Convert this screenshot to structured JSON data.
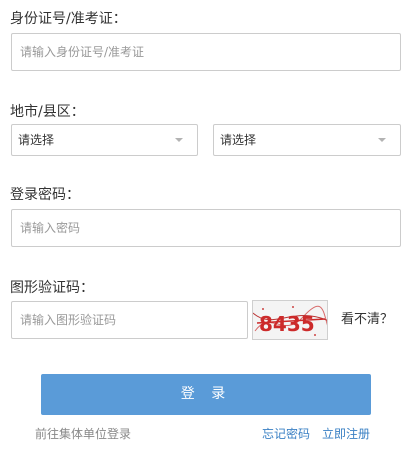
{
  "id_section": {
    "label": "身份证号/准考证：",
    "placeholder": "请输入身份证号/准考证"
  },
  "region_section": {
    "label": "地市/县区：",
    "city_select": "请选择",
    "county_select": "请选择"
  },
  "password_section": {
    "label": "登录密码：",
    "placeholder": "请输入密码"
  },
  "captcha_section": {
    "label": "图形验证码：",
    "placeholder": "请输入图形验证码",
    "captcha_text": "8435",
    "refresh_link": "看不清？"
  },
  "login_button": "登 录",
  "footer": {
    "group_login_link": "前往集体单位登录",
    "forgot_password_link": "忘记密码",
    "register_link": "立即注册"
  },
  "colors": {
    "primary_button": "#5a9bd8",
    "link_blue": "#3a80c4",
    "captcha_red": "#cc2a2a"
  }
}
